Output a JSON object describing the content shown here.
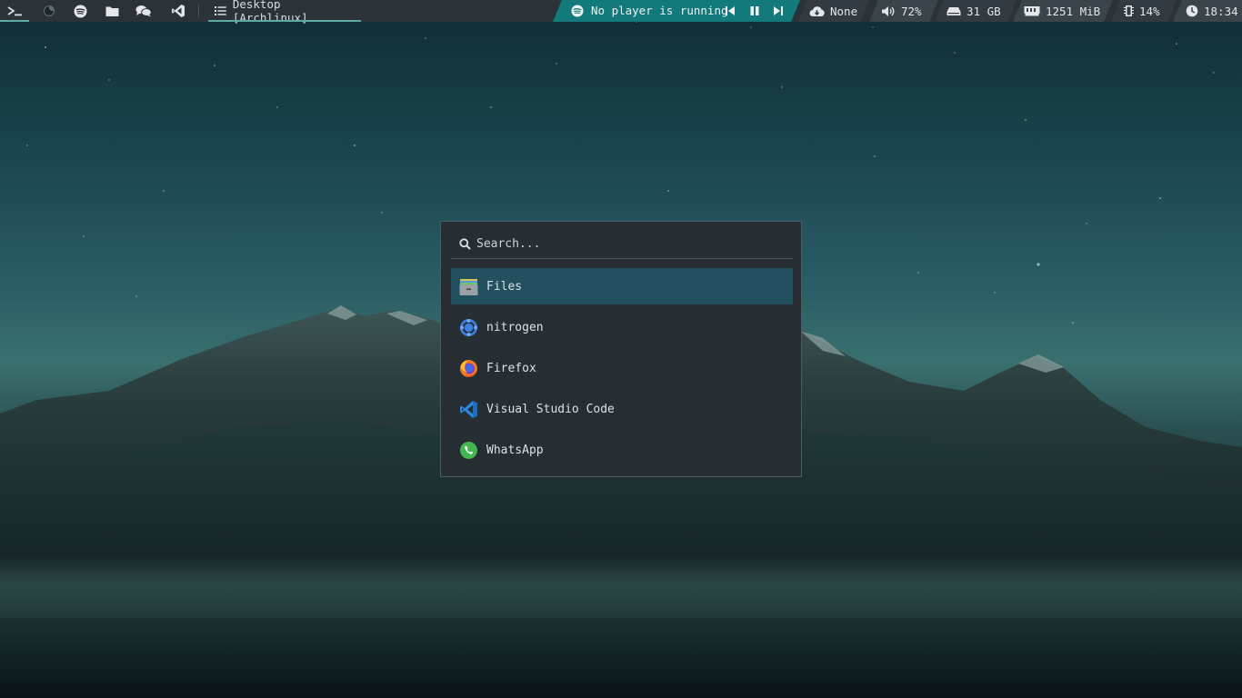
{
  "topbar": {
    "launcher_icons": [
      "terminal-icon",
      "firefox-dark-icon",
      "spotify-icon",
      "folder-icon",
      "chat-icon",
      "vscode-icon"
    ],
    "workspace": {
      "icon": "list-icon",
      "label": "Desktop [Archlinux]"
    },
    "player": {
      "icon": "spotify-icon",
      "status": "No player is running"
    },
    "modules": {
      "updates": {
        "icon": "cloud-download-icon",
        "value": "None"
      },
      "volume": {
        "icon": "volume-icon",
        "value": "72%"
      },
      "disk": {
        "icon": "hdd-icon",
        "value": "31 GB"
      },
      "memory": {
        "icon": "memory-icon",
        "value": "1251 MiB"
      },
      "cpu": {
        "icon": "cpu-icon",
        "value": "14%"
      },
      "clock": {
        "icon": "clock-icon",
        "value": "18:34"
      }
    },
    "colors": {
      "bar": "#2b3339",
      "accent": "#127a7a",
      "underline": "#5fa9a4"
    }
  },
  "launcher": {
    "search": {
      "placeholder": "Search...",
      "value": ""
    },
    "items": [
      {
        "label": "Files",
        "icon": "files-icon",
        "selected": true
      },
      {
        "label": "nitrogen",
        "icon": "nitrogen-icon",
        "selected": false
      },
      {
        "label": "Firefox",
        "icon": "firefox-icon",
        "selected": false
      },
      {
        "label": "Visual Studio Code",
        "icon": "vscode-icon",
        "selected": false
      },
      {
        "label": "WhatsApp",
        "icon": "whatsapp-icon",
        "selected": false
      }
    ],
    "colors": {
      "background": "#262e34",
      "selected": "#22505e"
    }
  }
}
